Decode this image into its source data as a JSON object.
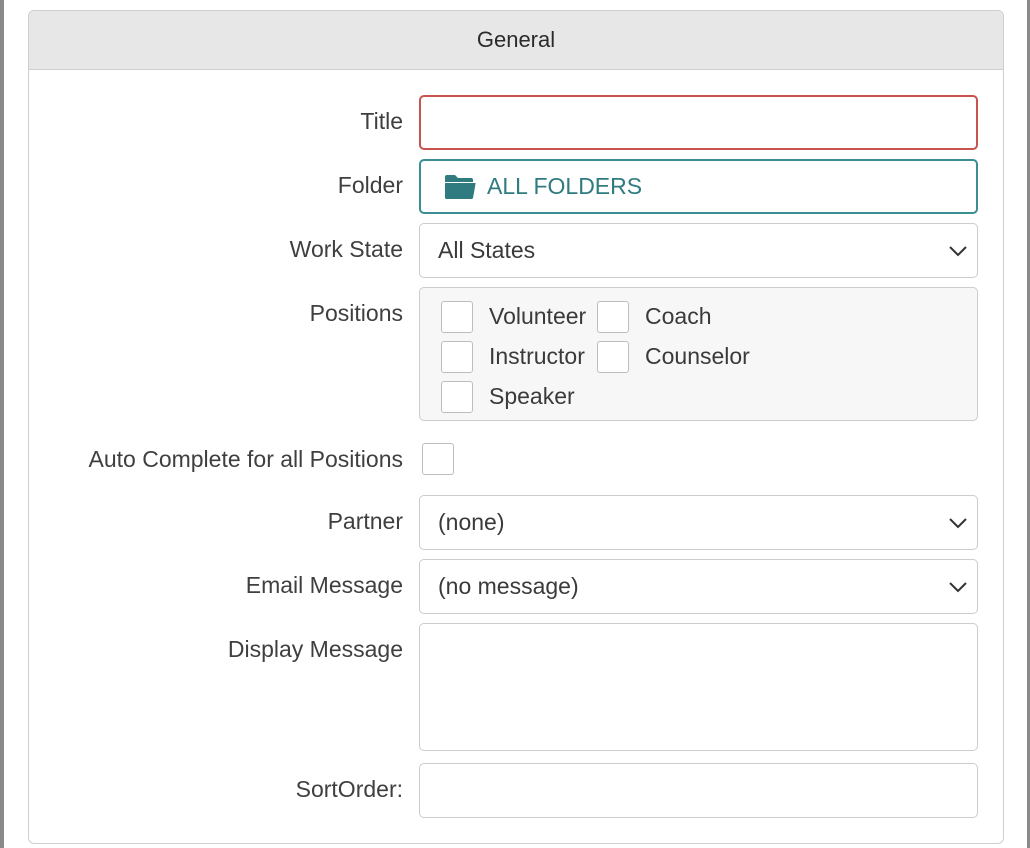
{
  "panel": {
    "title": "General"
  },
  "form": {
    "title_label": "Title",
    "title_value": "",
    "folder_label": "Folder",
    "folder_value": "ALL FOLDERS",
    "work_state_label": "Work State",
    "work_state_value": "All States",
    "positions_label": "Positions",
    "positions": [
      {
        "label": "Volunteer",
        "checked": false
      },
      {
        "label": "Coach",
        "checked": false
      },
      {
        "label": "Instructor",
        "checked": false
      },
      {
        "label": "Counselor",
        "checked": false
      },
      {
        "label": "Speaker",
        "checked": false
      }
    ],
    "auto_complete_label": "Auto Complete for all Positions",
    "auto_complete_checked": false,
    "partner_label": "Partner",
    "partner_value": "(none)",
    "email_message_label": "Email Message",
    "email_message_value": "(no message)",
    "display_message_label": "Display Message",
    "display_message_value": "",
    "sort_order_label": "SortOrder:",
    "sort_order_value": ""
  },
  "icons": {
    "folder": "folder-icon",
    "chevron": "chevron-down-icon"
  },
  "colors": {
    "error_border": "#c9534f",
    "accent_teal": "#3a8f93",
    "folder_text": "#2f7b7f"
  }
}
